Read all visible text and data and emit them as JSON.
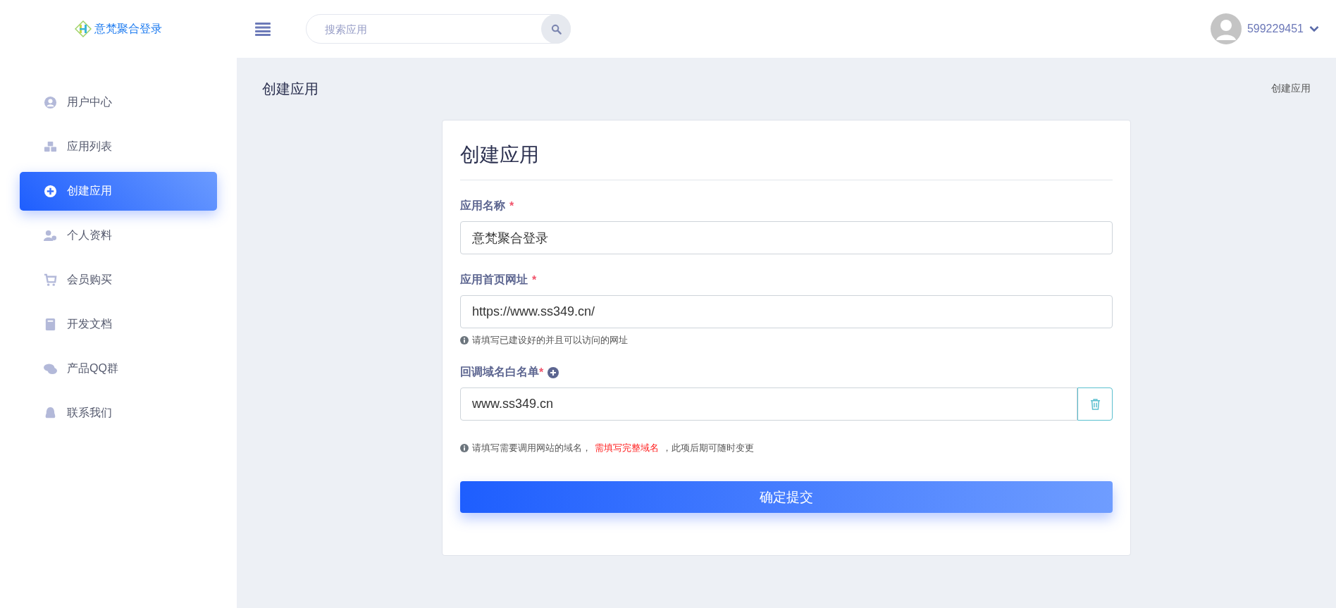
{
  "header": {
    "logo_text": "意梵聚合登录",
    "search": {
      "placeholder": "搜索应用"
    },
    "user": {
      "name": "599229451"
    }
  },
  "sidebar": {
    "items": [
      {
        "label": "用户中心",
        "selected": false
      },
      {
        "label": "应用列表",
        "selected": false
      },
      {
        "label": "创建应用",
        "selected": true
      },
      {
        "label": "个人资料",
        "selected": false
      },
      {
        "label": "会员购买",
        "selected": false
      },
      {
        "label": "开发文档",
        "selected": false
      },
      {
        "label": "产品QQ群",
        "selected": false
      },
      {
        "label": "联系我们",
        "selected": false
      }
    ]
  },
  "page": {
    "title": "创建应用",
    "breadcrumb": "创建应用"
  },
  "form": {
    "title": "创建应用",
    "fields": [
      {
        "kind": "text",
        "label": "应用名称",
        "required_mark": "*",
        "value": "意梵聚合登录"
      },
      {
        "kind": "text",
        "label": "应用首页网址",
        "required_mark": "*",
        "value": "https://www.ss349.cn/",
        "hint": [
          {
            "text": "请填写已建设好的并且可以访问的网址",
            "emphasis": false
          }
        ]
      },
      {
        "kind": "list",
        "label": "回调域名白名单",
        "required_mark": "*",
        "value": "www.ss349.cn",
        "hint": [
          {
            "text": "请填写需要调用网站的域名，",
            "emphasis": false
          },
          {
            "text": "需填写完整域名",
            "emphasis": true
          },
          {
            "text": "，此项后期可随时变更",
            "emphasis": false
          }
        ]
      }
    ],
    "submit": "确定提交"
  }
}
